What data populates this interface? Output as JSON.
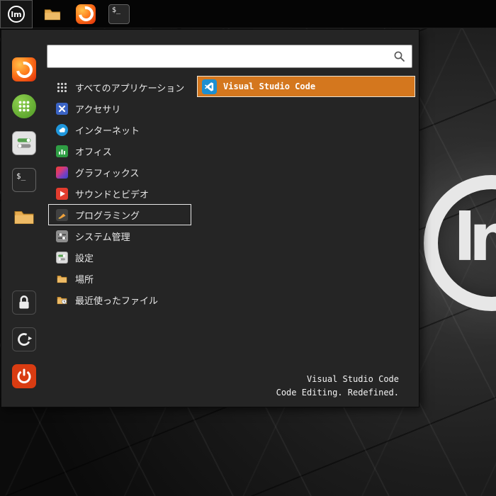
{
  "colors": {
    "panel_bg": "#050505",
    "menu_bg": "#252525",
    "accent_orange": "#d4771e",
    "selection_border": "#ece4d4",
    "category_box_border": "#e8e8e8",
    "search_bg": "#ffffff",
    "text_light": "#e8e8e8",
    "power_red": "#d93c12",
    "vscode_blue": "#1d8fd1"
  },
  "desktop": {
    "emblem": "lm"
  },
  "panel": {
    "menu_button": {
      "icon": "linuxmint-logo-icon"
    },
    "launchers": [
      {
        "icon": "files-icon"
      },
      {
        "icon": "firefox-icon"
      },
      {
        "icon": "terminal-icon",
        "label": "$_"
      }
    ]
  },
  "menu": {
    "search": {
      "placeholder": "",
      "icon": "search-icon"
    },
    "favorites": [
      {
        "icon": "firefox-icon"
      },
      {
        "icon": "software-manager-icon"
      },
      {
        "icon": "system-settings-icon"
      },
      {
        "icon": "terminal-icon",
        "label": "$_"
      },
      {
        "icon": "files-icon"
      }
    ],
    "session": [
      {
        "icon": "lock-screen-icon"
      },
      {
        "icon": "logout-icon"
      },
      {
        "icon": "quit-icon"
      }
    ],
    "categories": [
      {
        "label": "すべてのアプリケーション",
        "icon": "all-applications-icon",
        "highlighted": false
      },
      {
        "label": "アクセサリ",
        "icon": "accessories-icon",
        "highlighted": false
      },
      {
        "label": "インターネット",
        "icon": "internet-icon",
        "highlighted": false
      },
      {
        "label": "オフィス",
        "icon": "office-icon",
        "highlighted": false
      },
      {
        "label": "グラフィックス",
        "icon": "graphics-icon",
        "highlighted": false
      },
      {
        "label": "サウンドとビデオ",
        "icon": "sound-video-icon",
        "highlighted": false
      },
      {
        "label": "プログラミング",
        "icon": "programming-icon",
        "highlighted": true
      },
      {
        "label": "システム管理",
        "icon": "administration-icon",
        "highlighted": false
      },
      {
        "label": "設定",
        "icon": "preferences-icon",
        "highlighted": false
      },
      {
        "label": "場所",
        "icon": "places-icon",
        "highlighted": false
      },
      {
        "label": "最近使ったファイル",
        "icon": "recent-files-icon",
        "highlighted": false
      }
    ],
    "apps": [
      {
        "label": "Visual Studio Code",
        "icon": "vscode-icon",
        "selected": true
      }
    ],
    "selection_info": {
      "title": "Visual Studio Code",
      "subtitle": "Code Editing. Redefined."
    }
  }
}
